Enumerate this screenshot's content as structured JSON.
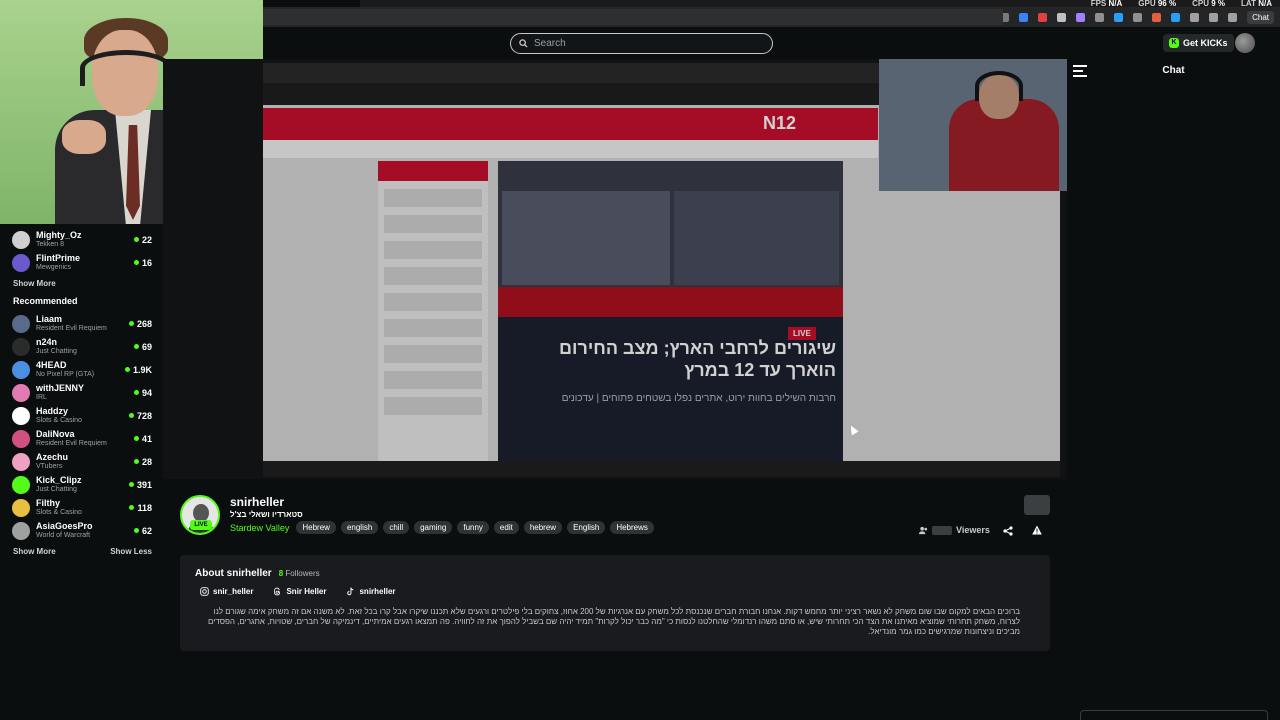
{
  "system_bar": {
    "fps_label": "FPS",
    "fps_value": "N/A",
    "gpu_label": "GPU",
    "gpu_value": "96 %",
    "cpu_label": "CPU",
    "cpu_value": "9 %",
    "lat_label": "LAT",
    "lat_value": "N/A"
  },
  "browser": {
    "chat_button": "Chat"
  },
  "header": {
    "search_placeholder": "Search",
    "get_kicks_label": "Get KICKs"
  },
  "sidebar": {
    "following": [
      {
        "name": "Mighty_Oz",
        "game": "Tekken 8",
        "viewers": "22",
        "avatar_color": "#cfcfcf"
      },
      {
        "name": "FlintPrime",
        "game": "Mewgenics",
        "viewers": "16",
        "avatar_color": "#6a5acd"
      }
    ],
    "show_more_1": "Show More",
    "recommended_heading": "Recommended",
    "recommended": [
      {
        "name": "Liaam",
        "game": "Resident Evil Requiem",
        "viewers": "268",
        "avatar_color": "#5a6a8a"
      },
      {
        "name": "n24n",
        "game": "Just Chatting",
        "viewers": "69",
        "avatar_color": "#2b2b2b"
      },
      {
        "name": "4HEAD",
        "game": "No Pixel RP (GTA)",
        "viewers": "1.9K",
        "avatar_color": "#4a90e2"
      },
      {
        "name": "withJENNY",
        "game": "IRL",
        "viewers": "94",
        "avatar_color": "#e07ab0"
      },
      {
        "name": "Haddzy",
        "game": "Slots & Casino",
        "viewers": "728",
        "avatar_color": "#ffffff"
      },
      {
        "name": "DaliNova",
        "game": "Resident Evil Requiem",
        "viewers": "41",
        "avatar_color": "#d05080"
      },
      {
        "name": "Azechu",
        "game": "VTubers",
        "viewers": "28",
        "avatar_color": "#f0a0c0"
      },
      {
        "name": "Kick_Clipz",
        "game": "Just Chatting",
        "viewers": "391",
        "avatar_color": "#53fc18"
      },
      {
        "name": "Filthy",
        "game": "Slots & Casino",
        "viewers": "118",
        "avatar_color": "#e8c040"
      },
      {
        "name": "AsiaGoesPro",
        "game": "World of Warcraft",
        "viewers": "62",
        "avatar_color": "#a0a0a0"
      }
    ],
    "show_more_2": "Show More",
    "show_less": "Show Less"
  },
  "video": {
    "site_logo": "N12",
    "headline": "שיגורים לרחבי הארץ; מצב החירום הוארך עד 12 במרץ",
    "subline": "חרבות השילים בחוות ירוט, אתרים נפלו בשטחים פתוחים | עדכונים",
    "live_badge": "LIVE"
  },
  "chat": {
    "title": "Chat"
  },
  "channel": {
    "name": "snirheller",
    "title": "סטארדיו ושאלי בצ'ל",
    "live_label": "LIVE",
    "category": "Stardew Valley",
    "tags": [
      "Hebrew",
      "english",
      "chill",
      "gaming",
      "funny",
      "edit",
      "hebrew",
      "English",
      "Hebrews"
    ],
    "viewers_label": "Viewers"
  },
  "about": {
    "title": "About snirheller",
    "followers_count": "8",
    "followers_label": "Followers",
    "socials": [
      {
        "platform": "instagram-icon",
        "handle": "snir_heller"
      },
      {
        "platform": "threads-icon",
        "handle": "Snir Heller"
      },
      {
        "platform": "tiktok-icon",
        "handle": "snirheller"
      }
    ],
    "bio": "ברוכים הבאים למקום שבו שום משחק לא נשאר רציני יותר מחמש דקות. אנחנו חבורת חברים שנכנסת לכל משחק עם אנרגיות של 200 אחוז, צחוקים בלי פילטרים ורגעים שלא תכננו שיקרו אבל קרו בכל זאת. לא משנה אם זה משחק אימה שגורם לנו לצרוח, משחק תחרותי שמוציא מאיתנו את הצד הכי תחרותי שיש, או סתם משהו רנדומלי שהחלטנו לנסות כי \"מה כבר יכול לקרות\" תמיד יהיה שם בשביל להפוך את זה לחוויה. פה תמצאו רגעים אמיתיים, דינמיקה של חברים, שטויות, אתגרים, הפסדים מביכים וניצחונות שמרגישים כמו גמר מונדיאל."
  }
}
